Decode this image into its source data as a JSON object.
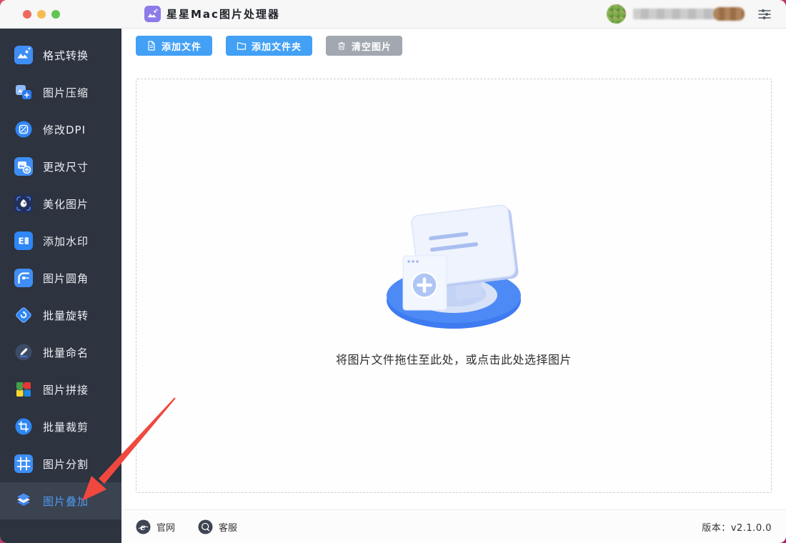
{
  "app": {
    "title": "星星Mac图片处理器"
  },
  "titlebar": {
    "traffic_lights": [
      "close",
      "minimize",
      "maximize"
    ],
    "user_name_redacted": true,
    "settings_icon": "sliders-icon"
  },
  "sidebar": {
    "items": [
      {
        "id": "format-convert",
        "label": "格式转换",
        "icon": "format-convert-icon",
        "active": false
      },
      {
        "id": "image-compress",
        "label": "图片压缩",
        "icon": "compress-icon",
        "active": false
      },
      {
        "id": "modify-dpi",
        "label": "修改DPI",
        "icon": "dpi-icon",
        "active": false
      },
      {
        "id": "resize",
        "label": "更改尺寸",
        "icon": "resize-icon",
        "active": false
      },
      {
        "id": "beautify",
        "label": "美化图片",
        "icon": "beautify-icon",
        "active": false
      },
      {
        "id": "watermark",
        "label": "添加水印",
        "icon": "watermark-icon",
        "active": false
      },
      {
        "id": "rounded-corner",
        "label": "图片圆角",
        "icon": "rounded-corner-icon",
        "active": false
      },
      {
        "id": "batch-rotate",
        "label": "批量旋转",
        "icon": "rotate-icon",
        "active": false
      },
      {
        "id": "batch-rename",
        "label": "批量命名",
        "icon": "rename-icon",
        "active": false
      },
      {
        "id": "image-stitch",
        "label": "图片拼接",
        "icon": "stitch-icon",
        "active": false
      },
      {
        "id": "batch-crop",
        "label": "批量裁剪",
        "icon": "batch-crop-icon",
        "active": false
      },
      {
        "id": "image-split",
        "label": "图片分割",
        "icon": "split-icon",
        "active": false
      },
      {
        "id": "image-overlay",
        "label": "图片叠加",
        "icon": "overlay-icon",
        "active": true
      }
    ]
  },
  "toolbar": {
    "buttons": [
      {
        "label": "添加文件",
        "icon": "file-icon",
        "style": "primary"
      },
      {
        "label": "添加文件夹",
        "icon": "folder-icon",
        "style": "primary"
      },
      {
        "label": "清空图片",
        "icon": "trash-icon",
        "style": "disabled"
      }
    ]
  },
  "dropzone": {
    "hint": "将图片文件拖住至此处，或点击此处选择图片"
  },
  "footer": {
    "links": [
      {
        "label": "官网",
        "icon": "globe-icon"
      },
      {
        "label": "客服",
        "icon": "chat-icon"
      }
    ],
    "version_label": "版本：",
    "version": "v2.1.0.0"
  },
  "annotation": {
    "type": "arrow",
    "color": "#F0483F",
    "points_to": "图片叠加"
  },
  "colors": {
    "accent": "#42A0F5",
    "sidebar_bg": "#2D333F",
    "sidebar_active_bg": "#3B4250",
    "sidebar_active_text": "#4E9BF0",
    "disabled_button": "#A2A8B0",
    "arrow": "#F0483F",
    "app_icon_purple": "#8E7BEA"
  }
}
